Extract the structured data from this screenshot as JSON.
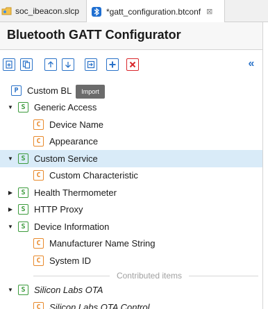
{
  "tabs": [
    {
      "label": "soc_ibeacon.slcp",
      "icon": "project-icon"
    },
    {
      "label": "*gatt_configuration.btconf",
      "icon": "bluetooth-icon",
      "close": "⊠"
    }
  ],
  "header": {
    "title": "Bluetooth GATT Configurator"
  },
  "toolbar": {
    "buttons": [
      "add-icon",
      "copy-icon",
      "move-up-icon",
      "move-down-icon",
      "import-icon",
      "plus-icon",
      "delete-icon"
    ],
    "collapse_label": "«"
  },
  "tooltip": {
    "text": "Import"
  },
  "tree": [
    {
      "badge": "P",
      "label": "Custom BL",
      "level": 0
    },
    {
      "badge": "S",
      "label": "Generic Access",
      "level": 0
    },
    {
      "badge": "C",
      "label": "Device Name",
      "level": 1
    },
    {
      "badge": "C",
      "label": "Appearance",
      "level": 1
    },
    {
      "badge": "S",
      "label": "Custom Service",
      "level": 0
    },
    {
      "badge": "C",
      "label": "Custom Characteristic",
      "level": 1
    },
    {
      "badge": "S",
      "label": "Health Thermometer",
      "level": 0
    },
    {
      "badge": "S",
      "label": "HTTP Proxy",
      "level": 0
    },
    {
      "badge": "S",
      "label": "Device Information",
      "level": 0
    },
    {
      "badge": "C",
      "label": "Manufacturer Name String",
      "level": 1
    },
    {
      "badge": "C",
      "label": "System ID",
      "level": 1
    }
  ],
  "contributed": {
    "label": "Contributed items",
    "items": [
      {
        "badge": "S",
        "label": "Silicon Labs OTA"
      },
      {
        "badge": "C",
        "label": "Silicon Labs OTA Control"
      }
    ]
  },
  "colors": {
    "accent": "#2a72c8",
    "service": "#3b9a3b",
    "characteristic": "#e8892b",
    "selected": "#d9ebf8",
    "delete": "#d9262b"
  }
}
